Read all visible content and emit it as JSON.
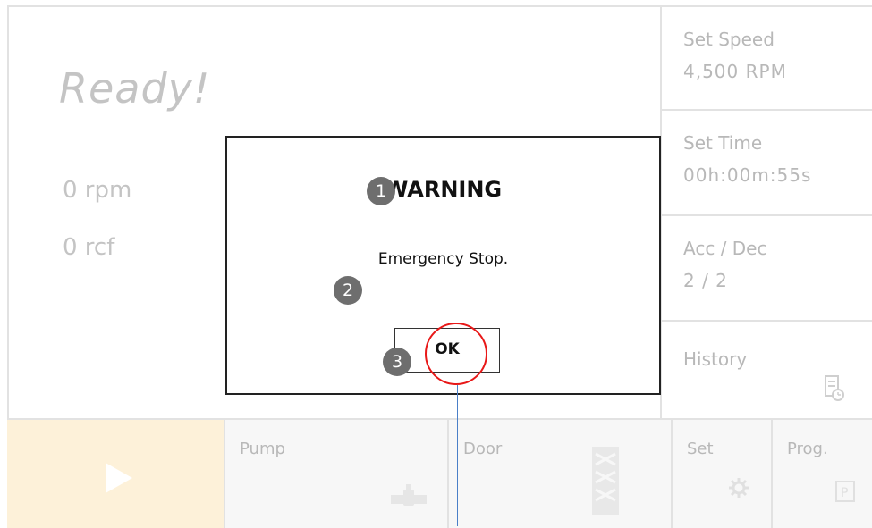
{
  "main": {
    "status": "Ready!",
    "speed_reading": "0 rpm",
    "force_reading": "0 rcf"
  },
  "side_panel": {
    "set_speed_label": "Set Speed",
    "set_speed_value": "4,500 RPM",
    "set_time_label": "Set Time",
    "set_time_value": "00h:00m:55s",
    "acc_dec_label": "Acc / Dec",
    "acc_dec_value": "2 / 2",
    "history_label": "History"
  },
  "bottom_bar": {
    "pump_label": "Pump",
    "door_label": "Door",
    "set_label": "Set",
    "prog_label": "Prog."
  },
  "dialog": {
    "title": "WARNING",
    "message": "Emergency Stop.",
    "ok_label": "OK"
  },
  "annotations": {
    "marker_1": "1",
    "marker_2": "2",
    "marker_3": "3"
  },
  "colors": {
    "start_button_bg": "#fdf1d9",
    "highlight_circle": "#e81818",
    "guide_line": "#4a7fc8",
    "marker_bg": "#6e6e6e"
  },
  "icons": [
    "play-icon",
    "pump-icon",
    "door-icon",
    "gear-icon",
    "prog-icon",
    "history-icon"
  ]
}
